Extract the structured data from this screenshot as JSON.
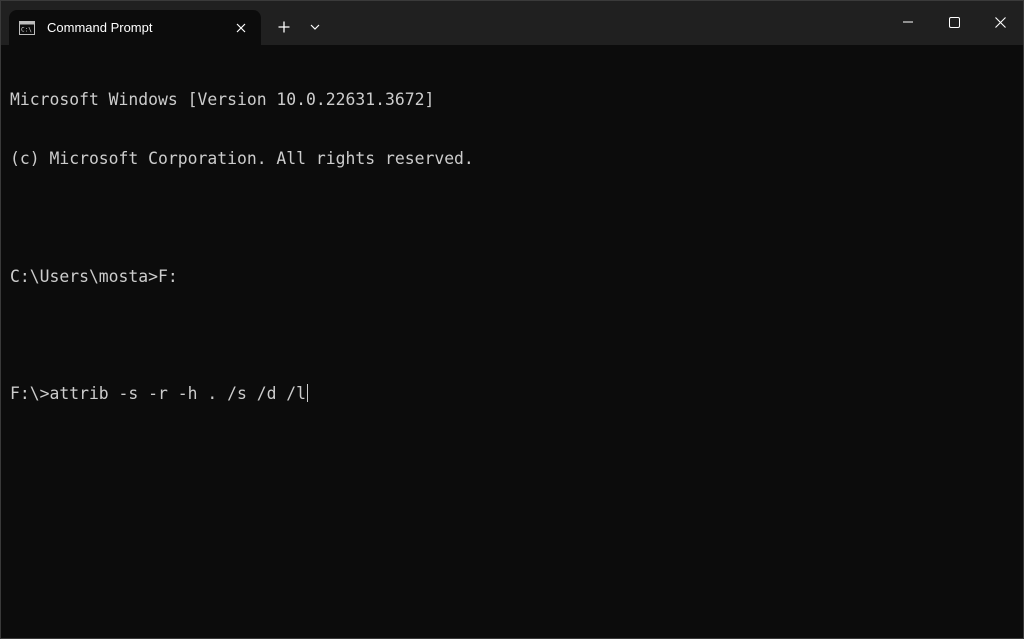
{
  "window": {
    "tab_title": "Command Prompt",
    "icons": {
      "tab": "terminal-icon",
      "tab_close": "close-icon",
      "new_tab": "plus-icon",
      "dropdown": "chevron-down-icon",
      "minimize": "minimize-icon",
      "maximize": "maximize-icon",
      "close": "close-icon"
    }
  },
  "terminal": {
    "lines": [
      "Microsoft Windows [Version 10.0.22631.3672]",
      "(c) Microsoft Corporation. All rights reserved.",
      "",
      "C:\\Users\\mosta>F:",
      "",
      "F:\\>attrib -s -r -h . /s /d /l"
    ]
  },
  "colors": {
    "titlebar_bg": "#202020",
    "terminal_bg": "#0c0c0c",
    "terminal_fg": "#cccccc",
    "icon_fg": "#ffffff"
  }
}
